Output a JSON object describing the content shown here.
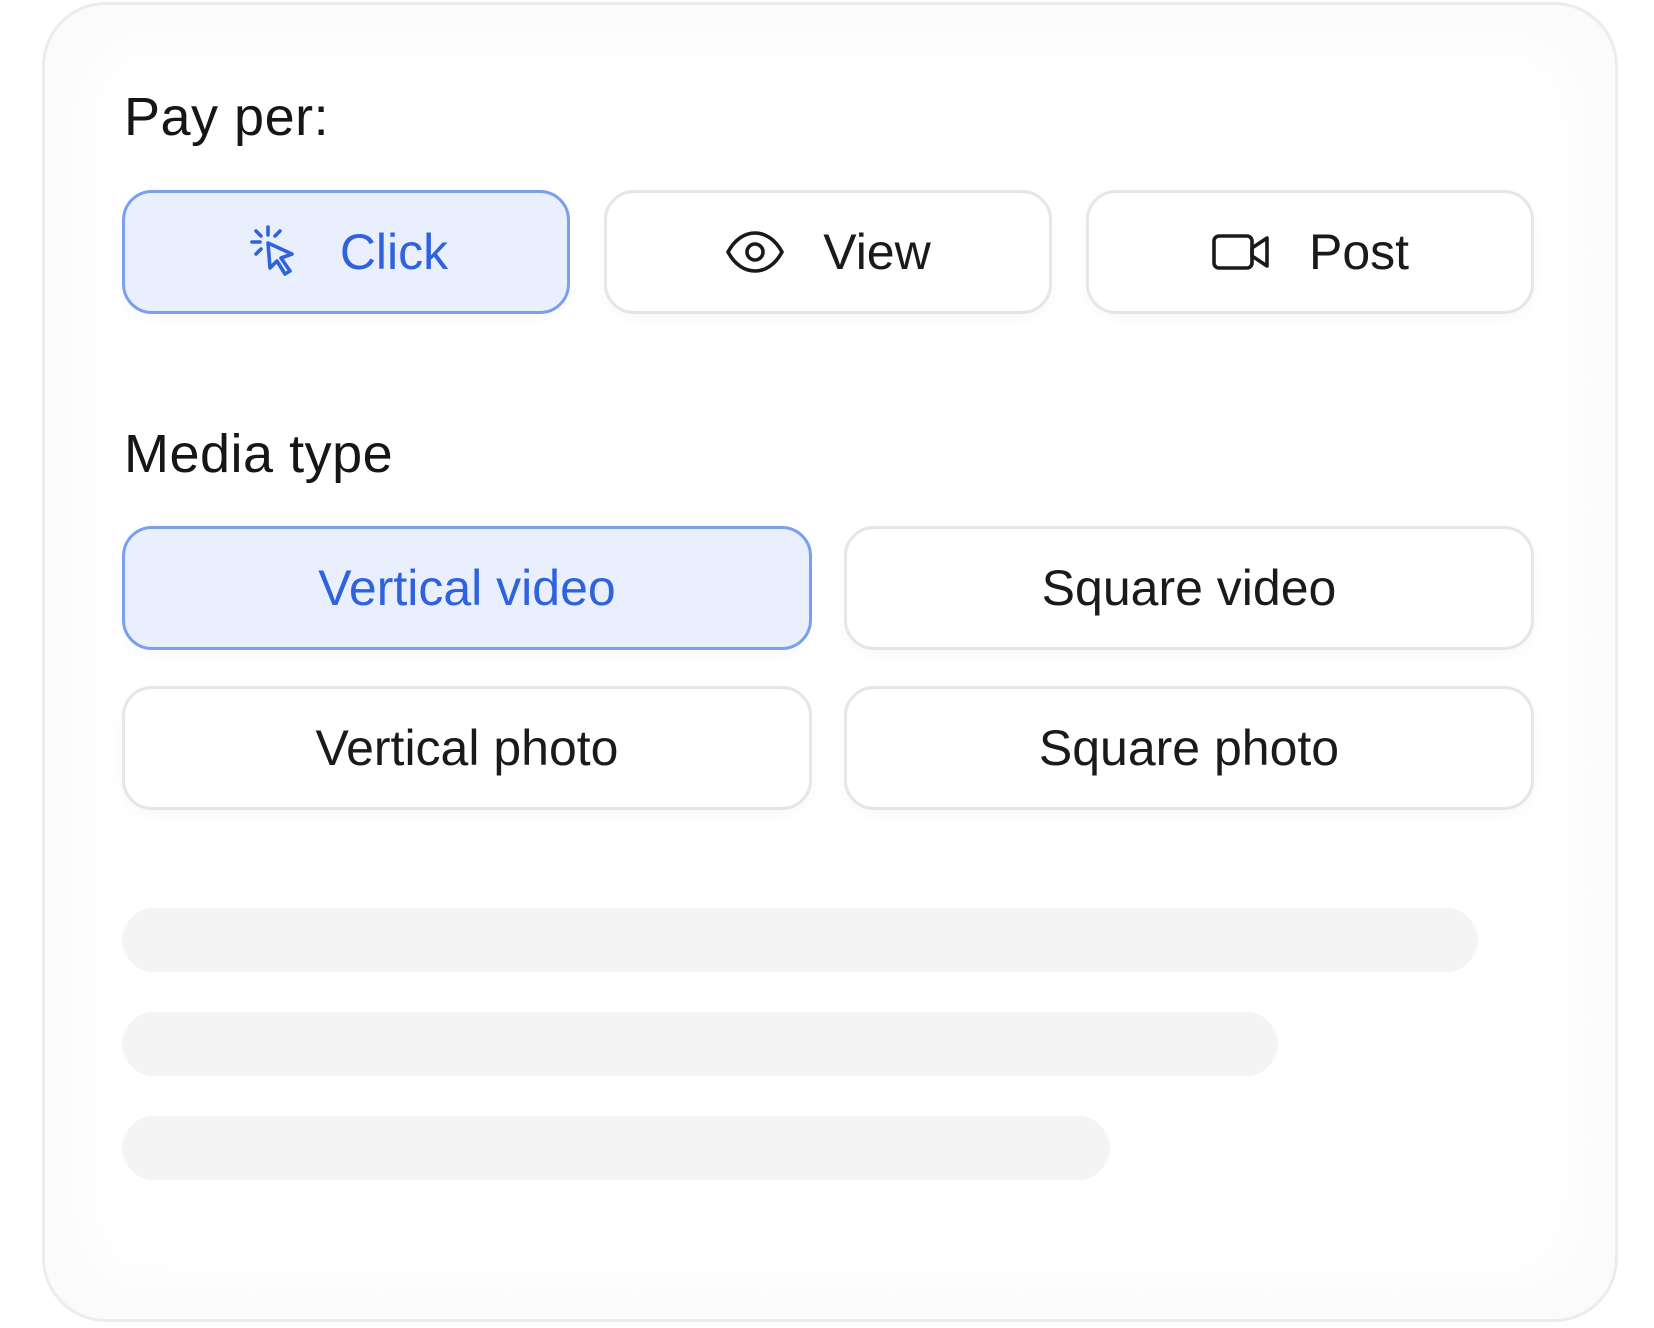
{
  "pay_per": {
    "title": "Pay per:",
    "options": [
      {
        "label": "Click",
        "icon": "cursor-click-icon",
        "selected": true
      },
      {
        "label": "View",
        "icon": "eye-icon",
        "selected": false
      },
      {
        "label": "Post",
        "icon": "video-camera-icon",
        "selected": false
      }
    ]
  },
  "media_type": {
    "title": "Media type",
    "options": [
      {
        "label": "Vertical video",
        "selected": true
      },
      {
        "label": "Square video",
        "selected": false
      },
      {
        "label": "Vertical photo",
        "selected": false
      },
      {
        "label": "Square photo",
        "selected": false
      }
    ]
  },
  "colors": {
    "accent": "#2f63de",
    "selected_bg": "#e9effd",
    "selected_border": "#7aa0ec",
    "border": "#e6e6e6",
    "skeleton": "#f4f4f4"
  }
}
